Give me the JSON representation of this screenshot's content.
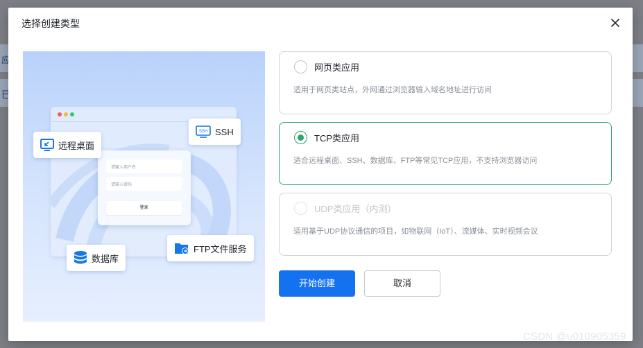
{
  "background": {
    "row1_text": "应",
    "row2_text": "已"
  },
  "dialog": {
    "title": "选择创建类型",
    "close_icon": "close-icon"
  },
  "illustration": {
    "tags": {
      "remote_desktop": "远程桌面",
      "ssh": "SSH",
      "ssh_icon_text": "SSH",
      "database": "数据库",
      "ftp": "FTP文件服务"
    },
    "login": {
      "username_placeholder": "请输入用户名",
      "password_placeholder": "请输入密码",
      "button": "登录"
    }
  },
  "options": [
    {
      "name": "网页类应用",
      "desc": "适用于网页类站点，外网通过浏览器输入域名地址进行访问",
      "state": "unselected"
    },
    {
      "name": "TCP类应用",
      "desc": "适合远程桌面、SSH、数据库、FTP等常见TCP应用，不支持浏览器访问",
      "state": "selected"
    },
    {
      "name": "UDP类应用（内测）",
      "desc": "适用基于UDP协议通信的项目，如物联网（IoT）、流媒体、实时视频会议",
      "state": "disabled"
    }
  ],
  "actions": {
    "start": "开始创建",
    "cancel": "取消"
  },
  "watermark": "CSDN @u010905359",
  "colors": {
    "primary": "#1471f0",
    "selected": "#2ea36b",
    "icon_blue": "#1677e6"
  }
}
